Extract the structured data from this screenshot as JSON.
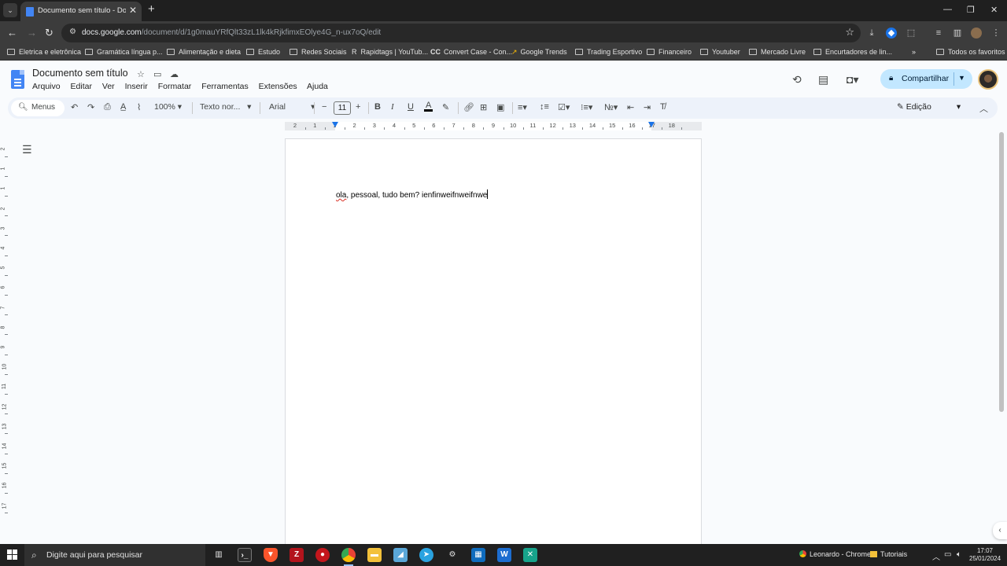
{
  "browser": {
    "tab_title": "Documento sem título - Docum",
    "url_host": "docs.google.com",
    "url_path": "/document/d/1g0mauYRfQlt33zL1lk4kRjkfimxEOlye4G_n-ux7oQ/edit",
    "bookmarks": [
      {
        "label": "Eletrica e eletrônica"
      },
      {
        "label": "Gramática língua p..."
      },
      {
        "label": "Alimentação e dieta"
      },
      {
        "label": "Estudo"
      },
      {
        "label": "Redes Sociais"
      },
      {
        "label": "Rapidtags | YouTub..."
      },
      {
        "label": "Convert Case - Con..."
      },
      {
        "label": "Google Trends"
      },
      {
        "label": "Trading Esportivo"
      },
      {
        "label": "Financeiro"
      },
      {
        "label": "Youtuber"
      },
      {
        "label": "Mercado Livre"
      },
      {
        "label": "Encurtadores de lin..."
      }
    ],
    "all_bookmarks": "Todos os favoritos"
  },
  "docs": {
    "title": "Documento sem título",
    "menus": [
      "Arquivo",
      "Editar",
      "Ver",
      "Inserir",
      "Formatar",
      "Ferramentas",
      "Extensões",
      "Ajuda"
    ],
    "share_label": "Compartilhar",
    "toolbar": {
      "search_label": "Menus",
      "zoom": "100%",
      "style": "Texto nor...",
      "font": "Arial",
      "font_size": "11",
      "mode": "Edição"
    },
    "ruler_labels": [
      "2",
      "1",
      "1",
      "2",
      "3",
      "4",
      "5",
      "6",
      "7",
      "8",
      "9",
      "10",
      "11",
      "12",
      "13",
      "14",
      "15",
      "16",
      "17",
      "18"
    ],
    "vruler_labels": [
      "2",
      "1",
      "1",
      "2",
      "3",
      "4",
      "5",
      "6",
      "7",
      "8",
      "9",
      "10",
      "11",
      "12",
      "13",
      "14",
      "15",
      "16",
      "17"
    ],
    "body_underlined": "ola",
    "body_rest": ", pessoal, tudo bem? ienfinweifnweifnwe"
  },
  "taskbar": {
    "search_placeholder": "Digite aqui para pesquisar",
    "chrome_label": "Leonardo - Chrome",
    "folder_label": "Tutoriais",
    "time": "17:07",
    "date": "25/01/2024"
  }
}
